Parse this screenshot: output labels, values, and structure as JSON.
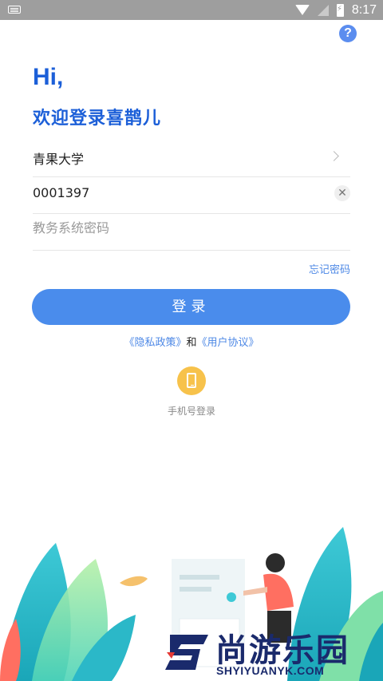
{
  "status_bar": {
    "time": "8:17"
  },
  "header": {
    "help_icon": "?",
    "greeting": "Hi,",
    "welcome": "欢迎登录喜鹊儿"
  },
  "form": {
    "school": "青果大学",
    "account": "0001397",
    "password_placeholder": "教务系统密码",
    "clear_symbol": "✕",
    "forgot": "忘记密码",
    "login_label": "登录"
  },
  "agreement": {
    "privacy": "《隐私政策》",
    "and": "和",
    "user": "《用户协议》"
  },
  "alt_login": {
    "icon": "phone-icon",
    "label": "手机号登录"
  },
  "watermark": {
    "brand": "尚游乐园",
    "url": "SHYIYUANYK.COM"
  },
  "colors": {
    "accent": "#4a8cec",
    "title_blue": "#1c5fd8",
    "phone_badge": "#f7c24b"
  }
}
